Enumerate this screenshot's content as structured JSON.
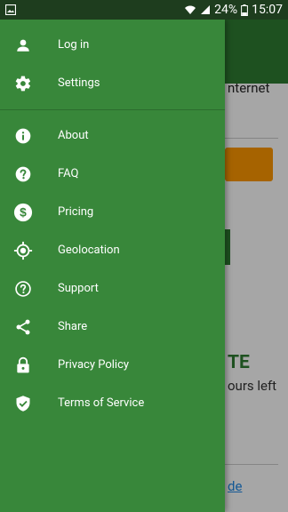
{
  "status_bar": {
    "battery": "24%",
    "time": "15:07",
    "icons": [
      "gallery-icon",
      "wifi-icon",
      "signal-icon",
      "battery-icon"
    ]
  },
  "background": {
    "partial_text_1": "nternet",
    "partial_text_2": "TE",
    "partial_text_3": "ours left",
    "partial_link": "de"
  },
  "drawer": {
    "items": [
      {
        "label": "Log in",
        "icon": "person-icon"
      },
      {
        "label": "Settings",
        "icon": "gear-icon"
      },
      {
        "label": "About",
        "icon": "info-icon"
      },
      {
        "label": "FAQ",
        "icon": "question-icon"
      },
      {
        "label": "Pricing",
        "icon": "dollar-icon"
      },
      {
        "label": "Geolocation",
        "icon": "location-target-icon"
      },
      {
        "label": "Support",
        "icon": "help-outline-icon"
      },
      {
        "label": "Share",
        "icon": "share-icon"
      },
      {
        "label": "Privacy Policy",
        "icon": "lock-icon"
      },
      {
        "label": "Terms of Service",
        "icon": "shield-check-icon"
      }
    ]
  },
  "colors": {
    "drawer_bg": "#38873a",
    "status_bar_bg": "#1e3d1e",
    "accent_orange": "#ff9800"
  }
}
